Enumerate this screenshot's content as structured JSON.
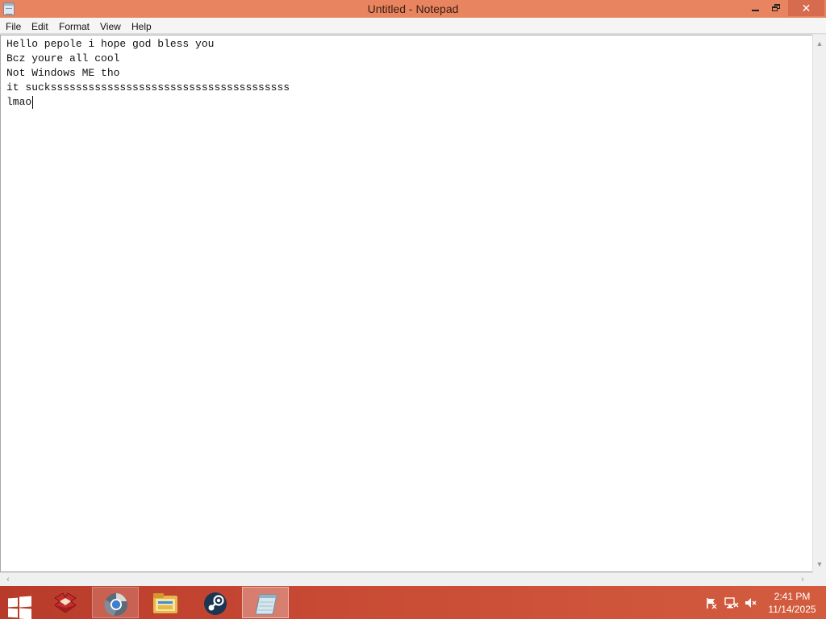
{
  "window": {
    "title": "Untitled - Notepad",
    "close_glyph": "✕"
  },
  "menu": {
    "items": [
      "File",
      "Edit",
      "Format",
      "View",
      "Help"
    ]
  },
  "editor": {
    "lines": [
      "Hello pepole i hope god bless you",
      "Bcz youre all cool",
      "Not Windows ME tho",
      "it suckssssssssssssssssssssssssssssssssssssss",
      "lmao"
    ]
  },
  "scroll": {
    "up_glyph": "▲",
    "down_glyph": "▼",
    "left_glyph": "‹",
    "right_glyph": "›"
  },
  "taskbar": {
    "apps": [
      "app-launcher-icon",
      "chrome-icon",
      "file-explorer-icon",
      "steam-icon",
      "notepad-icon"
    ],
    "clock": {
      "time": "2:41 PM",
      "date": "11/14/2025"
    }
  },
  "colors": {
    "titlebar": "#e8845f",
    "close_button": "#d66b4d",
    "taskbar": "#c84a34"
  }
}
